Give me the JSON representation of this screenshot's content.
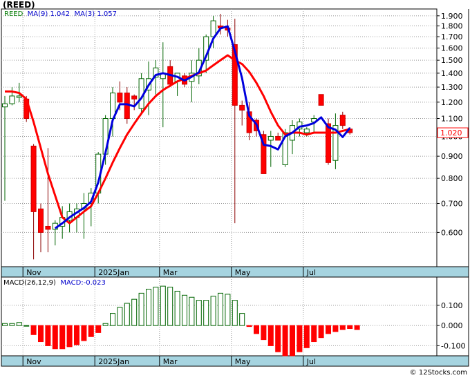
{
  "ticker": "(REED)",
  "legend": {
    "label": "REED",
    "ma9_label": "MA(9)",
    "ma9_value": "1.042",
    "ma3_label": "MA(3)",
    "ma3_value": "1.057"
  },
  "macd_legend": {
    "label": "MACD(26,12,9)",
    "value_label": "MACD:-0.023"
  },
  "credit": "© 12Stocks.com",
  "colors": {
    "up_candle": "#006400",
    "down_candle": "#ff0000",
    "ma9": "#ff0000",
    "ma3": "#0000dd",
    "axis_band": "#a6d4e0",
    "price_tag": "#ff0000"
  },
  "chart_data": [
    {
      "type": "candlestick",
      "title": "(REED)",
      "x_tick_labels": [
        "Nov",
        "2025Jan",
        "Mar",
        "May",
        "Jul"
      ],
      "y_ticks": [
        0.6,
        0.7,
        0.8,
        0.9,
        1.0,
        1.1,
        1.2,
        1.3,
        1.4,
        1.5,
        1.6,
        1.7,
        1.8,
        1.9
      ],
      "y_tick_labels": [
        "0.600",
        "0.700",
        "0.800",
        "0.900",
        "1.000",
        "1.100",
        "1.200",
        "1.300",
        "1.400",
        "1.500",
        "1.600",
        "1.700",
        "1.800",
        "1.900"
      ],
      "ylim": [
        0.5,
        1.97
      ],
      "y_scale": "log",
      "last_price_label": "1.020",
      "last_price": 1.02,
      "grid": true,
      "candles": [
        {
          "o": 1.17,
          "h": 1.24,
          "l": 0.71,
          "c": 1.19
        },
        {
          "o": 1.19,
          "h": 1.3,
          "l": 1.18,
          "c": 1.24
        },
        {
          "o": 1.23,
          "h": 1.33,
          "l": 1.2,
          "c": 1.24
        },
        {
          "o": 1.22,
          "h": 1.24,
          "l": 1.08,
          "c": 1.1
        },
        {
          "o": 0.95,
          "h": 0.96,
          "l": 0.52,
          "c": 0.67
        },
        {
          "o": 0.68,
          "h": 0.7,
          "l": 0.54,
          "c": 0.6
        },
        {
          "o": 0.62,
          "h": 0.94,
          "l": 0.54,
          "c": 0.61
        },
        {
          "o": 0.61,
          "h": 0.64,
          "l": 0.56,
          "c": 0.63
        },
        {
          "o": 0.62,
          "h": 0.69,
          "l": 0.58,
          "c": 0.65
        },
        {
          "o": 0.64,
          "h": 0.7,
          "l": 0.6,
          "c": 0.67
        },
        {
          "o": 0.65,
          "h": 0.7,
          "l": 0.6,
          "c": 0.68
        },
        {
          "o": 0.68,
          "h": 0.74,
          "l": 0.58,
          "c": 0.7
        },
        {
          "o": 0.7,
          "h": 0.76,
          "l": 0.62,
          "c": 0.74
        },
        {
          "o": 0.74,
          "h": 0.92,
          "l": 0.7,
          "c": 0.91
        },
        {
          "o": 0.91,
          "h": 1.12,
          "l": 0.86,
          "c": 1.1
        },
        {
          "o": 1.1,
          "h": 1.3,
          "l": 1.0,
          "c": 1.26
        },
        {
          "o": 1.26,
          "h": 1.34,
          "l": 1.15,
          "c": 1.2
        },
        {
          "o": 1.26,
          "h": 1.3,
          "l": 1.07,
          "c": 1.1
        },
        {
          "o": 1.24,
          "h": 1.25,
          "l": 1.15,
          "c": 1.22
        },
        {
          "o": 1.16,
          "h": 1.4,
          "l": 1.12,
          "c": 1.36
        },
        {
          "o": 1.28,
          "h": 1.49,
          "l": 1.12,
          "c": 1.36
        },
        {
          "o": 1.37,
          "h": 1.5,
          "l": 1.25,
          "c": 1.44
        },
        {
          "o": 1.36,
          "h": 1.65,
          "l": 1.05,
          "c": 1.4
        },
        {
          "o": 1.45,
          "h": 1.5,
          "l": 1.3,
          "c": 1.32
        },
        {
          "o": 1.34,
          "h": 1.4,
          "l": 1.24,
          "c": 1.4
        },
        {
          "o": 1.38,
          "h": 1.4,
          "l": 1.3,
          "c": 1.32
        },
        {
          "o": 1.34,
          "h": 1.5,
          "l": 1.2,
          "c": 1.4
        },
        {
          "o": 1.38,
          "h": 1.6,
          "l": 1.32,
          "c": 1.5
        },
        {
          "o": 1.5,
          "h": 1.72,
          "l": 1.4,
          "c": 1.7
        },
        {
          "o": 1.7,
          "h": 1.9,
          "l": 1.6,
          "c": 1.85
        },
        {
          "o": 1.8,
          "h": 1.92,
          "l": 1.72,
          "c": 1.78
        },
        {
          "o": 1.78,
          "h": 1.86,
          "l": 1.7,
          "c": 1.76
        },
        {
          "o": 1.63,
          "h": 1.87,
          "l": 0.63,
          "c": 1.18
        },
        {
          "o": 1.18,
          "h": 1.21,
          "l": 1.06,
          "c": 1.15
        },
        {
          "o": 1.14,
          "h": 1.2,
          "l": 0.98,
          "c": 1.02
        },
        {
          "o": 1.09,
          "h": 1.1,
          "l": 1.0,
          "c": 1.03
        },
        {
          "o": 1.01,
          "h": 1.03,
          "l": 0.82,
          "c": 0.82
        },
        {
          "o": 0.98,
          "h": 1.03,
          "l": 0.85,
          "c": 1.0
        },
        {
          "o": 1.0,
          "h": 1.02,
          "l": 0.98,
          "c": 0.98
        },
        {
          "o": 0.86,
          "h": 1.04,
          "l": 0.85,
          "c": 1.02
        },
        {
          "o": 0.98,
          "h": 1.09,
          "l": 0.91,
          "c": 1.06
        },
        {
          "o": 1.04,
          "h": 1.1,
          "l": 1.0,
          "c": 1.08
        },
        {
          "o": 1.02,
          "h": 1.05,
          "l": 1.0,
          "c": 1.04
        },
        {
          "o": 1.08,
          "h": 1.12,
          "l": 1.02,
          "c": 1.1
        },
        {
          "o": 1.25,
          "h": 1.25,
          "l": 1.18,
          "c": 1.18
        },
        {
          "o": 1.07,
          "h": 1.1,
          "l": 0.86,
          "c": 0.87
        },
        {
          "o": 0.88,
          "h": 1.13,
          "l": 0.84,
          "c": 1.06
        },
        {
          "o": 1.12,
          "h": 1.14,
          "l": 1.04,
          "c": 1.06
        },
        {
          "o": 1.04,
          "h": 1.05,
          "l": 1.01,
          "c": 1.02
        }
      ],
      "ma9_label": "MA(9)",
      "ma9": [
        1.27,
        1.27,
        1.26,
        1.22,
        1.08,
        0.94,
        0.82,
        0.73,
        0.65,
        0.63,
        0.65,
        0.67,
        0.69,
        0.74,
        0.8,
        0.87,
        0.94,
        1.01,
        1.07,
        1.13,
        1.19,
        1.24,
        1.28,
        1.31,
        1.34,
        1.36,
        1.38,
        1.4,
        1.42,
        1.46,
        1.5,
        1.54,
        1.5,
        1.47,
        1.41,
        1.33,
        1.24,
        1.14,
        1.06,
        1.01,
        1.02,
        1.02,
        1.01,
        1.02,
        1.02,
        1.02,
        1.02,
        1.03,
        1.04
      ]
    },
    {
      "type": "bar",
      "title": "MACD(26,12,9)",
      "x_tick_labels": [
        "Nov",
        "2025Jan",
        "Mar",
        "May",
        "Jul"
      ],
      "y_ticks": [
        -0.1,
        0.0,
        0.1
      ],
      "y_tick_labels": [
        "-0.100",
        "0.000",
        "0.100"
      ],
      "ylim": [
        -0.15,
        0.24
      ],
      "grid": true,
      "value_label": "MACD:-0.023",
      "values": [
        0.01,
        0.01,
        0.015,
        0.0,
        -0.045,
        -0.08,
        -0.1,
        -0.115,
        -0.115,
        -0.105,
        -0.095,
        -0.075,
        -0.055,
        -0.035,
        0.01,
        0.06,
        0.09,
        0.11,
        0.13,
        0.16,
        0.18,
        0.19,
        0.195,
        0.19,
        0.17,
        0.15,
        0.14,
        0.125,
        0.125,
        0.145,
        0.16,
        0.155,
        0.125,
        0.06,
        -0.005,
        -0.04,
        -0.07,
        -0.1,
        -0.13,
        -0.15,
        -0.15,
        -0.13,
        -0.11,
        -0.08,
        -0.06,
        -0.04,
        -0.03,
        -0.02,
        -0.015,
        -0.02
      ]
    }
  ]
}
